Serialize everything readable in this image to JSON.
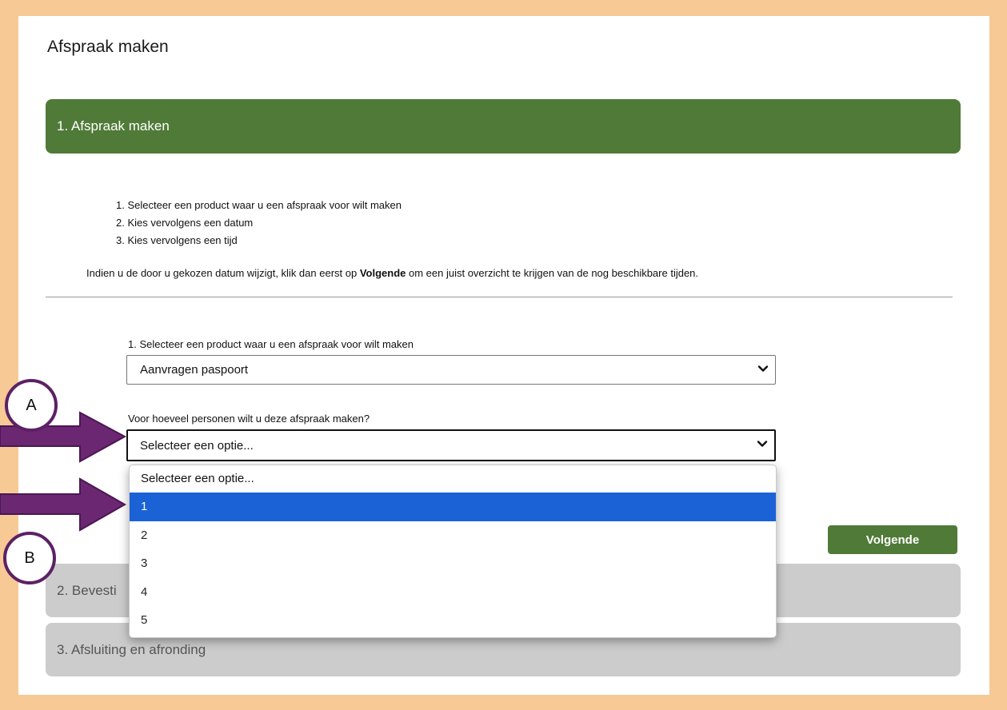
{
  "page": {
    "title": "Afspraak maken"
  },
  "steps": [
    {
      "label": "1. Afspraak maken"
    },
    {
      "label": "2. Bevesti"
    },
    {
      "label": "3. Afsluiting en afronding"
    }
  ],
  "instructions": [
    "1. Selecteer een product waar u een afspraak voor wilt maken",
    "2. Kies vervolgens een datum",
    "3. Kies vervolgens een tijd"
  ],
  "note": {
    "prefix": "Indien u de door u gekozen datum wijzigt, klik dan eerst op ",
    "bold": "Volgende",
    "suffix": " om een juist overzicht te krijgen van de nog beschikbare tijden."
  },
  "form": {
    "product_label": "1. Selecteer een product waar u een afspraak voor wilt maken",
    "product_value": "Aanvragen paspoort",
    "persons_label": "Voor hoeveel personen wilt u deze afspraak maken?",
    "persons_value": "Selecteer een optie...",
    "persons_options": [
      "Selecteer een optie...",
      "1",
      "2",
      "3",
      "4",
      "5"
    ],
    "persons_highlighted": "1"
  },
  "buttons": {
    "next_label": "Volgende"
  },
  "annotations": {
    "marker_a": "A",
    "marker_b": "B"
  },
  "colors": {
    "frame": "#f6c995",
    "accent_green": "#507a38",
    "highlight_blue": "#1a62d6",
    "annotation_purple": "#6b2772"
  }
}
